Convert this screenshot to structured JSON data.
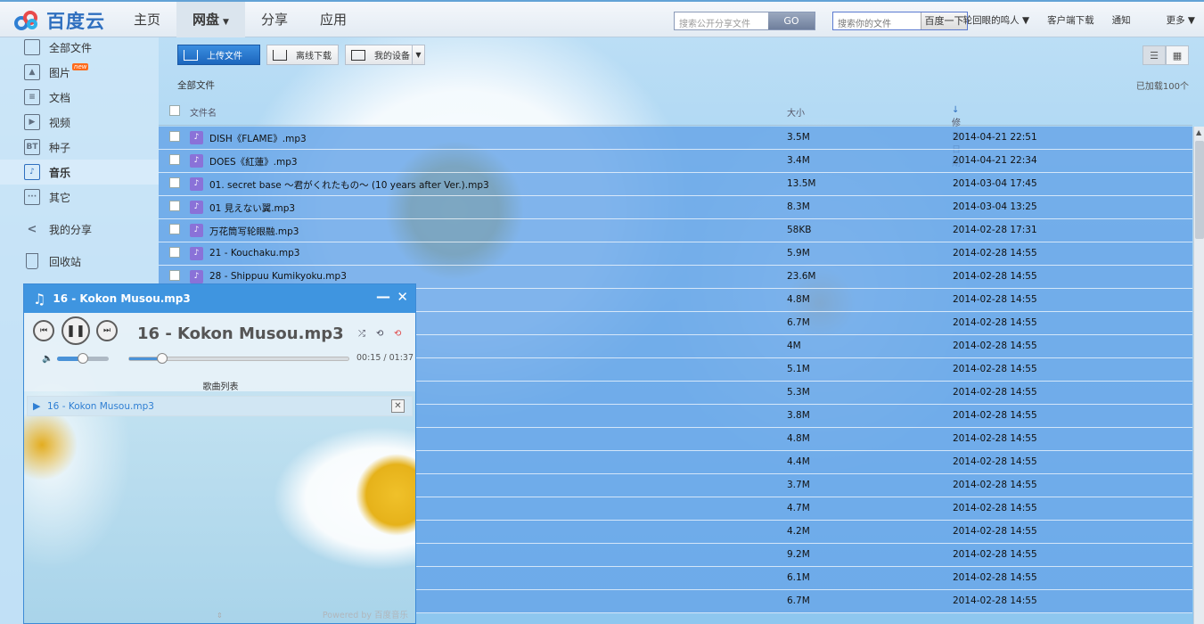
{
  "brand": {
    "name": "百度云"
  },
  "nav": [
    {
      "label": "主页"
    },
    {
      "label": "网盘"
    },
    {
      "label": "分享"
    },
    {
      "label": "应用"
    }
  ],
  "search_public": {
    "placeholder": "搜索公开分享文件",
    "button": "GO"
  },
  "search_own": {
    "placeholder": "搜索你的文件",
    "button": "百度一下"
  },
  "top_links": {
    "user": "轮回眼的鸣人",
    "client": "客户端下载",
    "notify": "通知",
    "more": "更多"
  },
  "sidebar": [
    {
      "label": "全部文件",
      "icon": "folder-icon"
    },
    {
      "label": "图片",
      "icon": "image-icon",
      "badge": "new"
    },
    {
      "label": "文档",
      "icon": "document-icon"
    },
    {
      "label": "视频",
      "icon": "video-icon"
    },
    {
      "label": "种子",
      "icon": "bt-icon",
      "icon_text": "BT"
    },
    {
      "label": "音乐",
      "icon": "music-icon"
    },
    {
      "label": "其它",
      "icon": "other-icon"
    },
    {
      "label": "我的分享",
      "icon": "share-icon"
    },
    {
      "label": "回收站",
      "icon": "trash-icon"
    }
  ],
  "toolbar": {
    "upload": "上传文件",
    "offline": "离线下载",
    "device": "我的设备"
  },
  "breadcrumb": "全部文件",
  "loaded_status": "已加载100个",
  "columns": {
    "name": "文件名",
    "size": "大小",
    "date": "修改日期"
  },
  "files": [
    {
      "name": "DISH《FLAME》.mp3",
      "size": "3.5M",
      "date": "2014-04-21 22:51"
    },
    {
      "name": "DOES《紅蓮》.mp3",
      "size": "3.4M",
      "date": "2014-04-21 22:34"
    },
    {
      "name": "01. secret base ～君がくれたもの～ (10 years after Ver.).mp3",
      "size": "13.5M",
      "date": "2014-03-04 17:45"
    },
    {
      "name": "01 見えない翼.mp3",
      "size": "8.3M",
      "date": "2014-03-04 13:25"
    },
    {
      "name": "万花筒写轮眼融.mp3",
      "size": "58KB",
      "date": "2014-02-28 17:31"
    },
    {
      "name": "21 - Kouchaku.mp3",
      "size": "5.9M",
      "date": "2014-02-28 14:55"
    },
    {
      "name": "28 - Shippuu Kumikyoku.mp3",
      "size": "23.6M",
      "date": "2014-02-28 14:55"
    },
    {
      "name": "",
      "size": "4.8M",
      "date": "2014-02-28 14:55"
    },
    {
      "name": "",
      "size": "6.7M",
      "date": "2014-02-28 14:55"
    },
    {
      "name": "",
      "size": "4M",
      "date": "2014-02-28 14:55"
    },
    {
      "name": "",
      "size": "5.1M",
      "date": "2014-02-28 14:55"
    },
    {
      "name": "",
      "size": "5.3M",
      "date": "2014-02-28 14:55"
    },
    {
      "name": "",
      "size": "3.8M",
      "date": "2014-02-28 14:55"
    },
    {
      "name": "",
      "size": "4.8M",
      "date": "2014-02-28 14:55"
    },
    {
      "name": "",
      "size": "4.4M",
      "date": "2014-02-28 14:55"
    },
    {
      "name": "",
      "size": "3.7M",
      "date": "2014-02-28 14:55"
    },
    {
      "name": "",
      "size": "4.7M",
      "date": "2014-02-28 14:55"
    },
    {
      "name": "",
      "size": "4.2M",
      "date": "2014-02-28 14:55"
    },
    {
      "name": "",
      "size": "9.2M",
      "date": "2014-02-28 14:55"
    },
    {
      "name": "",
      "size": "6.1M",
      "date": "2014-02-28 14:55"
    },
    {
      "name": "",
      "size": "6.7M",
      "date": "2014-02-28 14:55"
    }
  ],
  "player": {
    "title": "16 - Kokon Musou.mp3",
    "song": "16 - Kokon Musou.mp3",
    "time": "00:15 / 01:37",
    "progress": 0.15,
    "volume": 0.5,
    "playlist_label": "歌曲列表",
    "playlist": [
      {
        "name": "16 - Kokon Musou.mp3"
      }
    ],
    "powered": "Powered by 百度音乐"
  },
  "colors": {
    "accent": "#3f95e0",
    "row": "#67a5e8",
    "badge": "#ff6a1a"
  }
}
